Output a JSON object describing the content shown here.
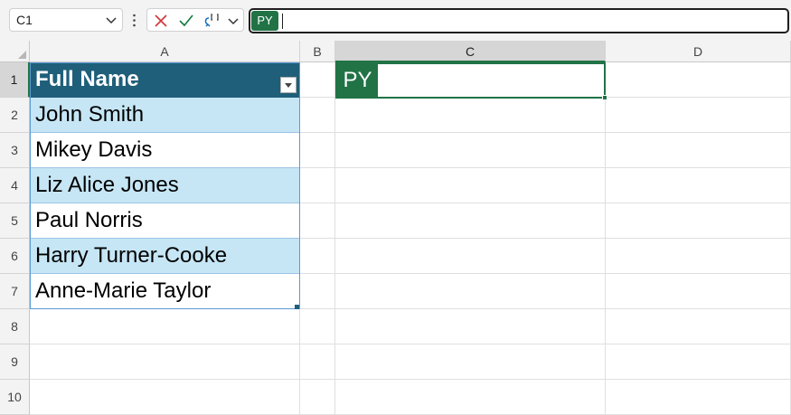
{
  "formula_bar": {
    "name_box": "C1",
    "formula_prefix": "PY",
    "formula_text": ""
  },
  "columns": [
    "A",
    "B",
    "C",
    "D"
  ],
  "rows": [
    "1",
    "2",
    "3",
    "4",
    "5",
    "6",
    "7",
    "8",
    "9",
    "10"
  ],
  "table": {
    "header": "Full Name",
    "values": [
      "John Smith",
      "Mikey Davis",
      "Liz Alice Jones",
      "Paul Norris",
      "Harry Turner-Cooke",
      "Anne-Marie Taylor"
    ]
  },
  "active_cell": {
    "badge": "PY"
  },
  "colors": {
    "excel_green": "#217346",
    "table_header": "#1f5f7a",
    "table_band": "#c6e6f5"
  }
}
